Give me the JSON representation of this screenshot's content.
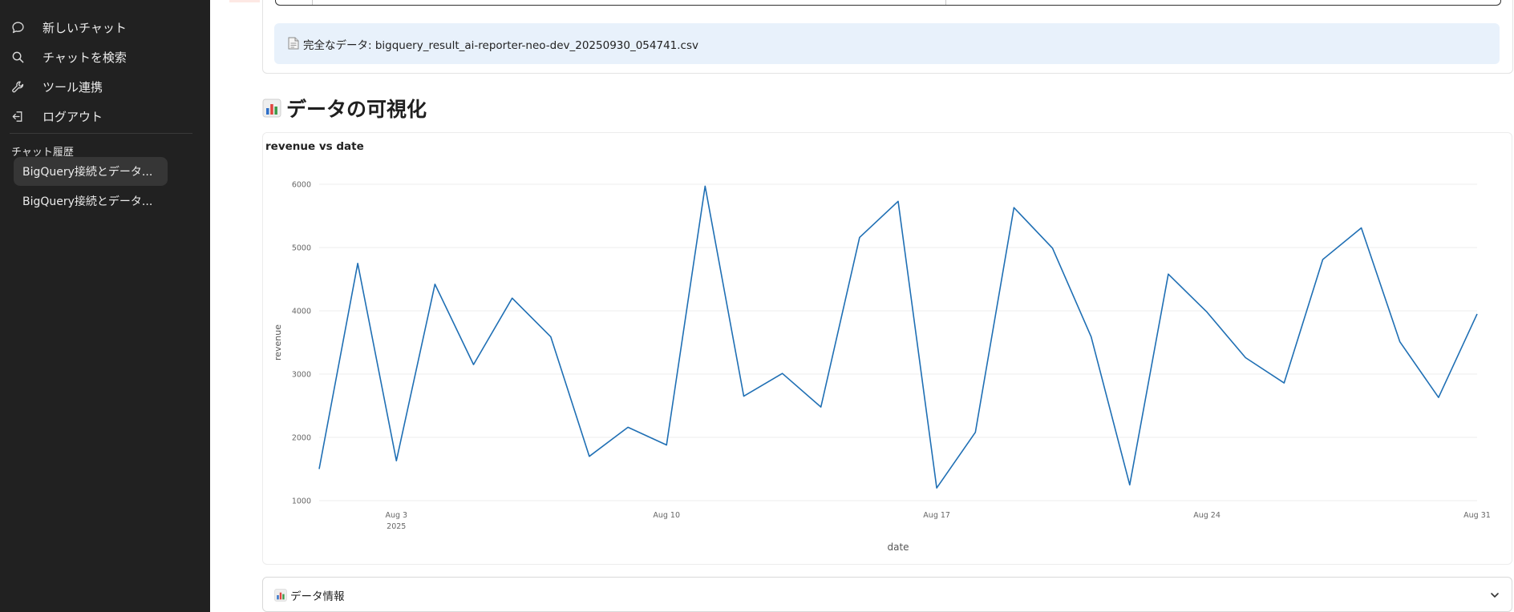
{
  "sidebar": {
    "nav": [
      {
        "label": "新しいチャット",
        "icon": "chat-bubble-icon"
      },
      {
        "label": "チャットを検索",
        "icon": "search-icon"
      },
      {
        "label": "ツール連携",
        "icon": "wrench-icon"
      },
      {
        "label": "ログアウト",
        "icon": "logout-icon"
      }
    ],
    "history_title": "チャット履歴",
    "history": [
      {
        "label": "BigQuery接続とデータ...",
        "active": true
      },
      {
        "label": "BigQuery接続とデータ...",
        "active": false
      }
    ]
  },
  "main": {
    "full_data_prefix": "完全なデータ: ",
    "full_data_file": "bigquery_result_ai-reporter-neo-dev_20250930_054741.csv",
    "section_title": "データの可視化",
    "data_info_label": "データ情報"
  },
  "colors": {
    "sidebar_bg": "#212121",
    "banner_bg": "#e8f1fb",
    "line": "#1f6fb4"
  },
  "chart_data": {
    "type": "line",
    "title": "revenue vs date",
    "xlabel": "date",
    "ylabel": "revenue",
    "ylim": [
      1000,
      6000
    ],
    "yticks": [
      1000,
      2000,
      3000,
      4000,
      5000,
      6000
    ],
    "xtick_labels": [
      "Aug 3\n2025",
      "Aug 10",
      "Aug 17",
      "Aug 24",
      "Aug 31"
    ],
    "grid": true,
    "legend": "none",
    "x": [
      "2025-08-01",
      "2025-08-02",
      "2025-08-03",
      "2025-08-04",
      "2025-08-05",
      "2025-08-06",
      "2025-08-07",
      "2025-08-08",
      "2025-08-09",
      "2025-08-10",
      "2025-08-11",
      "2025-08-12",
      "2025-08-13",
      "2025-08-14",
      "2025-08-15",
      "2025-08-16",
      "2025-08-17",
      "2025-08-18",
      "2025-08-19",
      "2025-08-20",
      "2025-08-21",
      "2025-08-22",
      "2025-08-23",
      "2025-08-24",
      "2025-08-25",
      "2025-08-26",
      "2025-08-27",
      "2025-08-28",
      "2025-08-29",
      "2025-08-30",
      "2025-08-31"
    ],
    "series": [
      {
        "values": [
          1500,
          4750,
          1630,
          4420,
          3150,
          4200,
          3590,
          1700,
          2160,
          1880,
          5970,
          2650,
          3010,
          2480,
          5160,
          5730,
          1200,
          2080,
          5630,
          4990,
          3590,
          1250,
          4580,
          3980,
          3260,
          2860,
          4810,
          5310,
          3510,
          2630,
          3950
        ]
      }
    ]
  }
}
